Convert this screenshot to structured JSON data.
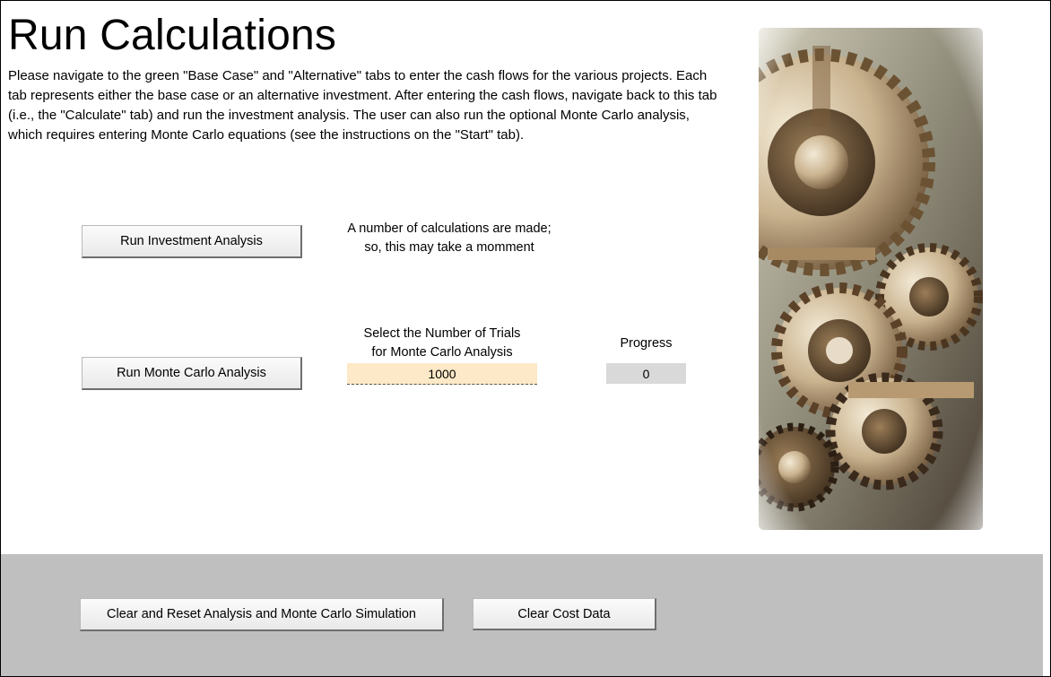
{
  "page": {
    "title": "Run Calculations",
    "intro": "Please navigate to the green \"Base Case\" and \"Alternative\" tabs to enter the cash flows for the various projects. Each tab represents either the base case or an alternative investment. After entering the cash flows, navigate back to this tab (i.e., the \"Calculate\" tab) and run the investment analysis. The user can also run the optional Monte Carlo analysis, which requires entering Monte Carlo equations (see the instructions on the \"Start\" tab)."
  },
  "investment": {
    "button_label": "Run Investment Analysis",
    "note_line1": "A number of calculations are made;",
    "note_line2": "so, this may take a momment"
  },
  "monte_carlo": {
    "button_label": "Run Monte Carlo Analysis",
    "trials_label_line1": "Select the Number of Trials",
    "trials_label_line2": "for Monte Carlo Analysis",
    "trials_value": "1000",
    "progress_label": "Progress",
    "progress_value": "0"
  },
  "bottom": {
    "reset_label": "Clear and Reset Analysis and Monte Carlo Simulation",
    "clear_cost_label": "Clear Cost Data"
  },
  "image": {
    "icon": "gears-photo",
    "colors": {
      "metal_light": "#e8dcc8",
      "metal_dark": "#3a2a1c",
      "bg": "#8a8a7a"
    }
  }
}
